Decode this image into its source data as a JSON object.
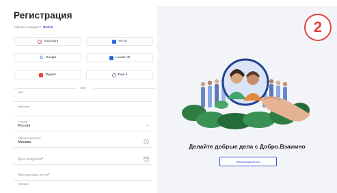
{
  "form": {
    "title": "Регистрация",
    "have_account_text": "Уже есть аккаунт?",
    "login_link": "Войти",
    "sso_buttons": [
      {
        "label": "Госуслуги",
        "icon": "gosuslugi-icon"
      },
      {
        "label": "VK ID",
        "icon": "vk-icon"
      },
      {
        "label": "Google",
        "icon": "google-icon"
      },
      {
        "label": "Leader-ID",
        "icon": "leader-id-icon"
      },
      {
        "label": "Яндекс",
        "icon": "yandex-icon"
      },
      {
        "label": "Еще 6",
        "icon": "more-icon"
      }
    ],
    "or_text": "ИЛИ",
    "fields": {
      "first_name": {
        "label": "Имя"
      },
      "last_name": {
        "label": "Фамилия"
      },
      "country": {
        "label": "Страна",
        "value": "Россия"
      },
      "city": {
        "label": "Населенный пункт",
        "value": "Москва"
      },
      "birth_date": {
        "placeholder": "Дата рождения"
      },
      "email": {
        "placeholder": "Электронная почта"
      },
      "phone": {
        "label": "Телефон"
      }
    },
    "required_mark": "*"
  },
  "hero": {
    "slogan": "Делайте добрые дела с Добро.Взаимно",
    "join_button": "Присоединиться"
  },
  "step_badge": "2",
  "colors": {
    "accent": "#3b51d9",
    "badge": "#e2413b",
    "panel_bg": "#f3f4f8"
  }
}
